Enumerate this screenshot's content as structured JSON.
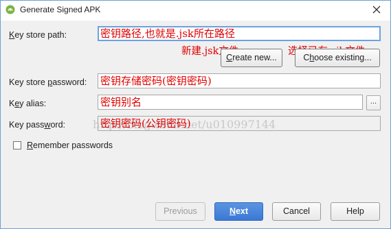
{
  "window": {
    "title": "Generate Signed APK",
    "app_icon": "android-icon",
    "close_icon": "close-icon"
  },
  "form": {
    "key_store_path": {
      "label_pre": "",
      "label_mnemonic": "K",
      "label_post": "ey store path:",
      "value": "密钥路径,也就是.jsk所在路径"
    },
    "create_new_button": {
      "mnemonic": "C",
      "rest": "reate new..."
    },
    "choose_existing_button": {
      "pre": "C",
      "mnemonic": "h",
      "rest": "oose existing..."
    },
    "key_store_password": {
      "label_pre": "Key store ",
      "label_mnemonic": "p",
      "label_post": "assword:",
      "value": "密钥存储密码(密钥密码)"
    },
    "key_alias": {
      "label_pre": "K",
      "label_mnemonic": "e",
      "label_post": "y alias:",
      "value": "密钥别名",
      "browse_label": "..."
    },
    "key_password": {
      "label_pre": "Key pass",
      "label_mnemonic": "w",
      "label_post": "ord:",
      "value": "密钥密码(公钥密码)"
    },
    "remember_passwords": {
      "mnemonic": "R",
      "rest": "emember passwords",
      "checked": false
    }
  },
  "annotations": {
    "create_new_note": "新建.jsk文件",
    "choose_existing_note": "选择已有.sjk文件"
  },
  "watermark": "http://blog.csdn.net/u010997144",
  "footer": {
    "previous_label": "Previous",
    "next_mnemonic": "N",
    "next_rest": "ext",
    "cancel_label": "Cancel",
    "help_label": "Help"
  },
  "colors": {
    "annotation": "#e00000",
    "primary_button": "#3b78d6",
    "focus_border": "#6ca2e0",
    "dialog_bg": "#f0f0f0"
  }
}
